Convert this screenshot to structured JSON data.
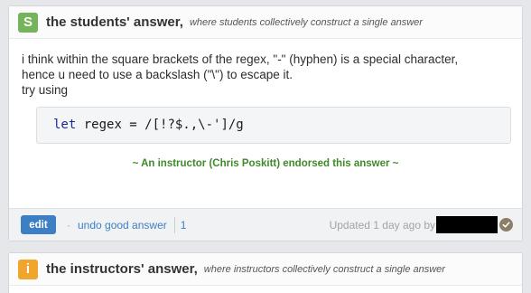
{
  "students_card": {
    "badge": "S",
    "title": "the students' answer,",
    "subtitle": "where students collectively construct a single answer",
    "body_line1": "i think within the square brackets of the regex, \"-\" (hyphen) is a special character,",
    "body_line2": "hence u need to use a backslash (\"\\\") to escape it.",
    "body_line3": "try using",
    "code_keyword": "let",
    "code_rest": " regex = /[!?$.,\\-']/g",
    "endorsement": "~ An instructor (Chris Poskitt) endorsed this answer ~",
    "footer": {
      "edit_label": "edit",
      "dot": "·",
      "undo_label": "undo good answer",
      "count": "1",
      "updated_text": "Updated 1 day ago by"
    }
  },
  "instructors_card": {
    "badge": "i",
    "title": "the instructors' answer,",
    "subtitle": "where instructors collectively construct a single answer"
  },
  "colors": {
    "students_badge": "#74b45a",
    "instructors_badge": "#f0a52c",
    "link": "#3c7fc4",
    "endorse": "#3f8a2a"
  },
  "icons": {
    "endorse_check": "check-circle-icon"
  }
}
